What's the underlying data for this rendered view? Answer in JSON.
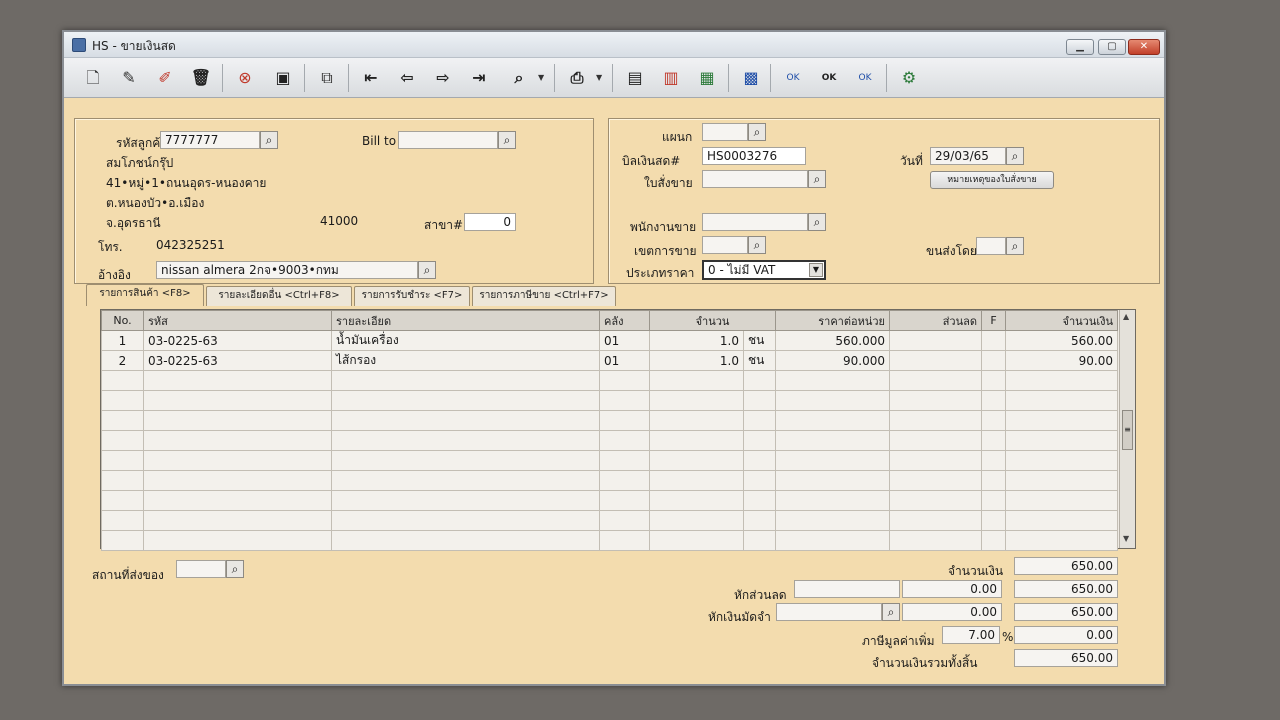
{
  "window": {
    "title": "HS - ขายเงินสด"
  },
  "customer": {
    "code_label": "รหัสลูกค้า",
    "code_value": "7777777",
    "bill_to_label": "Bill to",
    "bill_to_value": "",
    "name": "สมโภชน์กรุ๊ป",
    "address1": "41•หมู่•1•ถนนอุดร-หนองคาย",
    "address2": "ต.หนองบัว•อ.เมือง",
    "province": "จ.อุดรธานี",
    "postcode": "41000",
    "branch_label": "สาขา#",
    "branch_value": "0",
    "phone_label": "โทร.",
    "phone_value": "042325251",
    "ref_label": "อ้างอิง",
    "ref_value": "nissan almera 2กจ•9003•กทม"
  },
  "invoice": {
    "dept_label": "แผนก",
    "dept_value": "",
    "bill_label": "บิลเงินสด#",
    "bill_value": "HS0003276",
    "order_label": "ใบสั่งขาย",
    "order_value": "",
    "date_label": "วันที่",
    "date_value": "29/03/65",
    "order_note_button": "หมายเหตุของใบสั่งขาย",
    "salesperson_label": "พนักงานขาย",
    "salesperson_value": "",
    "zone_label": "เขตการขาย",
    "zone_value": "",
    "ship_by_label": "ขนส่งโดย",
    "ship_by_value": "",
    "price_type_label": "ประเภทราคา",
    "price_type_value": "0 - ไม่มี VAT"
  },
  "tabs": [
    {
      "label": "รายการสินค้า <F8>"
    },
    {
      "label": "รายละเอียดอื่น <Ctrl+F8>"
    },
    {
      "label": "รายการรับชำระ <F7>"
    },
    {
      "label": "รายการภาษีขาย <Ctrl+F7>"
    }
  ],
  "grid": {
    "headers": {
      "no": "No.",
      "code": "รหัส",
      "desc": "รายละเอียด",
      "wh": "คลัง",
      "qty": "จำนวน",
      "unit_price": "ราคาต่อหน่วย",
      "discount": "ส่วนลด",
      "f": "F",
      "amount": "จำนวนเงิน"
    },
    "rows": [
      {
        "no": "1",
        "code": "03-0225-63",
        "desc": "น้ำมันเครื่อง",
        "wh": "01",
        "qty": "1.0",
        "unit": "ชน",
        "unit_price": "560.000",
        "discount": "",
        "f": "",
        "amount": "560.00"
      },
      {
        "no": "2",
        "code": "03-0225-63",
        "desc": "ไส้กรอง",
        "wh": "01",
        "qty": "1.0",
        "unit": "ชน",
        "unit_price": "90.000",
        "discount": "",
        "f": "",
        "amount": "90.00"
      }
    ]
  },
  "footer": {
    "ship_to_label": "สถานที่ส่งของ",
    "ship_to_value": "",
    "amount_label": "จำนวนเงิน",
    "amount_value": "650.00",
    "discount_label": "หักส่วนลด",
    "discount_input": "",
    "discount_value": "0.00",
    "discount_net": "650.00",
    "deposit_label": "หักเงินมัดจำ",
    "deposit_input": "",
    "deposit_value": "0.00",
    "deposit_net": "650.00",
    "vat_label": "ภาษีมูลค่าเพิ่ม",
    "vat_rate": "7.00",
    "vat_pct": "%",
    "vat_value": "0.00",
    "total_label": "จำนวนเงินรวมทั้งสิ้น",
    "total_value": "650.00"
  }
}
